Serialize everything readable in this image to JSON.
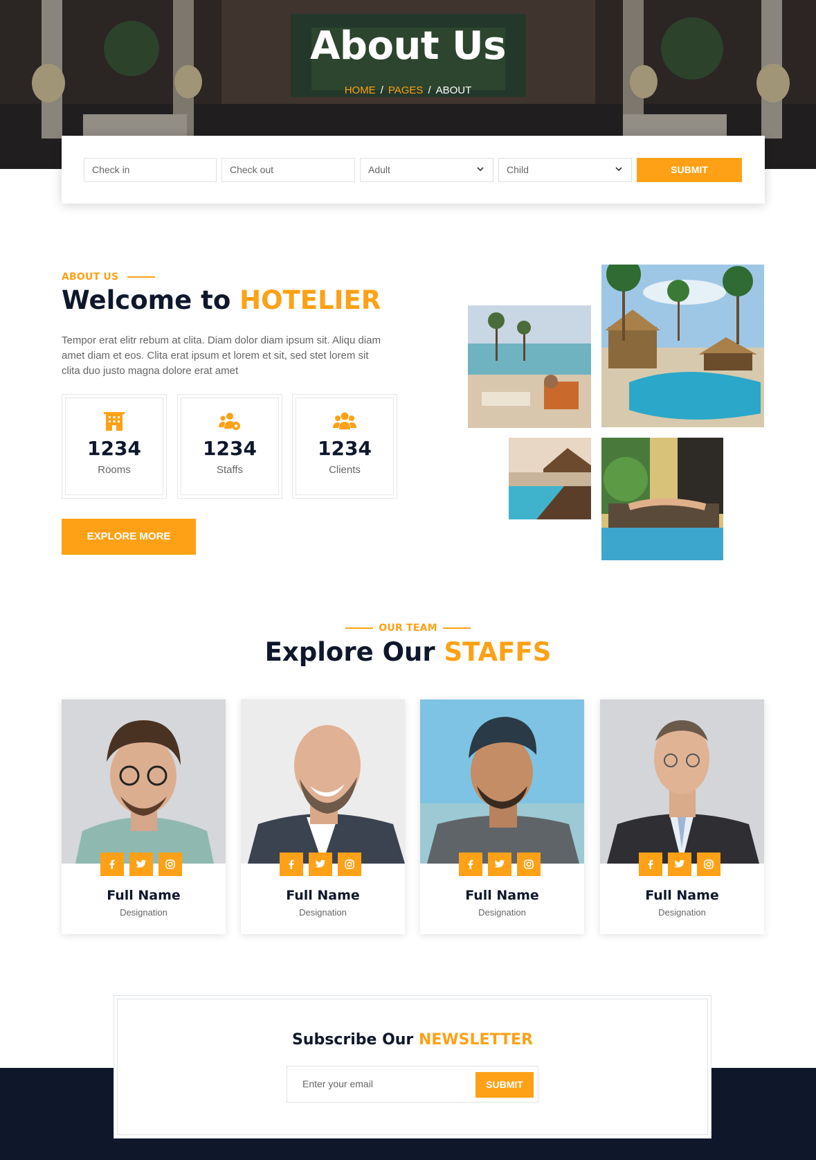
{
  "colors": {
    "accent": "#fea116",
    "dark": "#0f172b",
    "text": "#666565",
    "border": "#dee2e6"
  },
  "hero": {
    "title": "About Us",
    "breadcrumb": {
      "home": "HOME",
      "pages": "PAGES",
      "current": "ABOUT",
      "separator": "/"
    }
  },
  "booking": {
    "checkin_placeholder": "Check in",
    "checkout_placeholder": "Check out",
    "adult_selected": "Adult",
    "child_selected": "Child",
    "submit_label": "SUBMIT"
  },
  "about": {
    "eyebrow": "ABOUT US",
    "heading_prefix": "Welcome to ",
    "heading_accent": "HOTELIER",
    "paragraph": "Tempor erat elitr rebum at clita. Diam dolor diam ipsum sit. Aliqu diam amet diam et eos. Clita erat ipsum et lorem et sit, sed stet lorem sit clita duo justo magna dolore erat amet",
    "stats": [
      {
        "icon": "hotel-icon",
        "value": "1234",
        "label": "Rooms"
      },
      {
        "icon": "users-cog-icon",
        "value": "1234",
        "label": "Staffs"
      },
      {
        "icon": "users-icon",
        "value": "1234",
        "label": "Clients"
      }
    ],
    "explore_label": "EXPLORE MORE"
  },
  "team": {
    "eyebrow": "OUR TEAM",
    "heading_prefix": "Explore Our ",
    "heading_accent": "STAFFS",
    "members": [
      {
        "name": "Full Name",
        "designation": "Designation"
      },
      {
        "name": "Full Name",
        "designation": "Designation"
      },
      {
        "name": "Full Name",
        "designation": "Designation"
      },
      {
        "name": "Full Name",
        "designation": "Designation"
      }
    ]
  },
  "newsletter": {
    "heading_prefix": "Subscribe Our ",
    "heading_accent": "NEWSLETTER",
    "email_placeholder": "Enter your email",
    "submit_label": "SUBMIT"
  }
}
